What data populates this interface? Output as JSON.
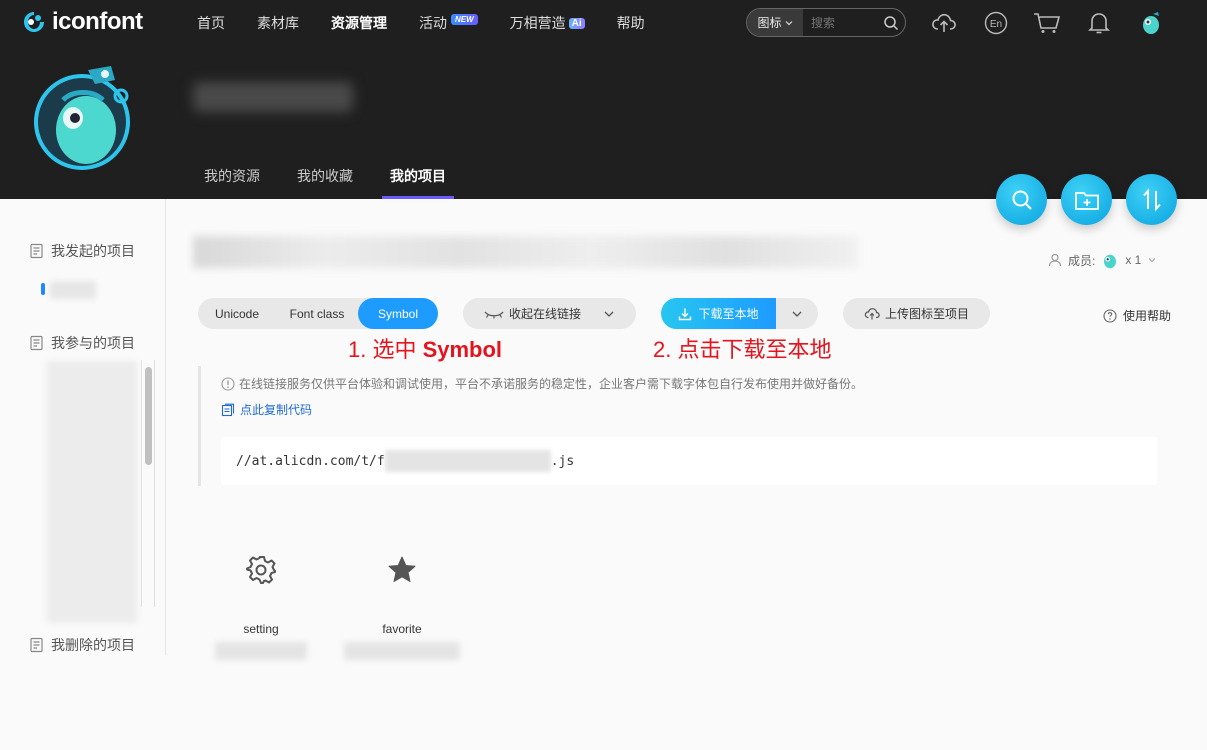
{
  "header": {
    "logo_text": "iconfont",
    "nav": [
      {
        "label": "首页"
      },
      {
        "label": "素材库"
      },
      {
        "label": "资源管理"
      },
      {
        "label": "活动",
        "badge": "NEW"
      },
      {
        "label": "万相营造",
        "badge": "Ai"
      },
      {
        "label": "帮助"
      }
    ],
    "search": {
      "type_label": "图标",
      "placeholder": "搜索"
    },
    "lang_label": "En",
    "icons": [
      "upload-icon",
      "language-icon",
      "cart-icon",
      "bell-icon",
      "user-avatar"
    ]
  },
  "profile": {
    "tabs": [
      "我的资源",
      "我的收藏",
      "我的项目"
    ],
    "active_tab": "我的项目"
  },
  "sidebar": {
    "sections": [
      {
        "label": "我发起的项目"
      },
      {
        "label": "我参与的项目"
      },
      {
        "label": "我删除的项目"
      }
    ]
  },
  "project": {
    "members_label": "成员:",
    "members_count": "x 1",
    "format_tabs": [
      "Unicode",
      "Font class",
      "Symbol"
    ],
    "active_format": "Symbol",
    "collapse_link_label": "收起在线链接",
    "download_label": "下载至本地",
    "upload_label": "上传图标至项目",
    "help_label": "使用帮助",
    "notice": "在线链接服务仅供平台体验和调试使用，平台不承诺服务的稳定性，企业客户需下载字体包自行发布使用并做好备份。",
    "copy_code_label": "点此复制代码",
    "code_prefix": "//at.alicdn.com/t/f",
    "code_suffix": ".js",
    "icons": [
      {
        "name": "setting"
      },
      {
        "name": "favorite"
      }
    ]
  },
  "annotations": {
    "step1_prefix": "1. 选中 ",
    "step1_bold": "Symbol",
    "step2": "2. 点击下载至本地"
  },
  "colors": {
    "accent_blue": "#1e9bff",
    "cyan": "#27c6f0",
    "annotation_red": "#e3141d",
    "tab_underline": "#6b5cff"
  }
}
